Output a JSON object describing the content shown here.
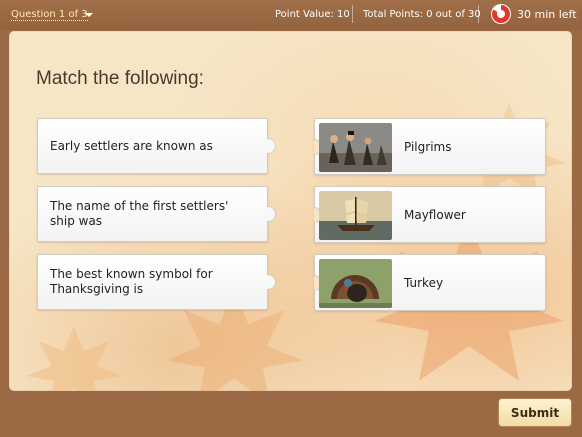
{
  "topbar": {
    "question_selector": "Question 1 of 3",
    "point_value": "Point Value: 10",
    "total_points": "Total Points: 0 out of 30",
    "timer": "30 min left"
  },
  "question": {
    "title": "Match the following:"
  },
  "left_items": [
    {
      "text": "Early settlers are known as"
    },
    {
      "text": "The name of the first settlers' ship was"
    },
    {
      "text": "The best known symbol for Thanksgiving is"
    }
  ],
  "right_items": [
    {
      "text": "Pilgrims",
      "image_icon": "pilgrims-image"
    },
    {
      "text": "Mayflower",
      "image_icon": "ship-image"
    },
    {
      "text": "Turkey",
      "image_icon": "turkey-image"
    }
  ],
  "footer": {
    "submit_label": "Submit"
  },
  "colors": {
    "frame": "#9b6a45",
    "panel": "#f6e6c6",
    "accent_link": "#ffe9a8",
    "timer_red": "#e03a2f"
  }
}
